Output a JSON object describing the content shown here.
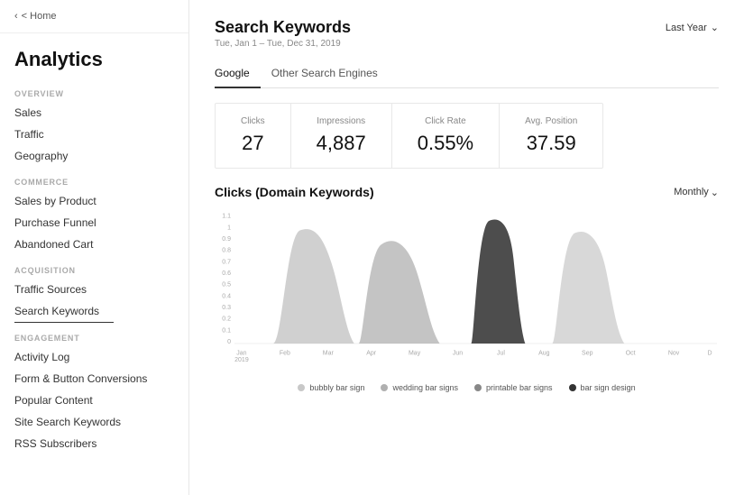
{
  "sidebar": {
    "home_label": "< Home",
    "title": "Analytics",
    "sections": [
      {
        "label": "OVERVIEW",
        "items": [
          "Sales",
          "Traffic",
          "Geography"
        ]
      },
      {
        "label": "COMMERCE",
        "items": [
          "Sales by Product",
          "Purchase Funnel",
          "Abandoned Cart"
        ]
      },
      {
        "label": "ACQUISITION",
        "items": [
          "Traffic Sources",
          "Search Keywords"
        ]
      },
      {
        "label": "ENGAGEMENT",
        "items": [
          "Activity Log",
          "Form & Button Conversions",
          "Popular Content",
          "Site Search Keywords",
          "RSS Subscribers"
        ]
      }
    ],
    "active_item": "Search Keywords"
  },
  "main": {
    "page_title": "Search Keywords",
    "page_date": "Tue, Jan 1 – Tue, Dec 31, 2019",
    "date_range": "Last Year",
    "tabs": [
      "Google",
      "Other Search Engines"
    ],
    "active_tab": "Google",
    "stats": [
      {
        "label": "Clicks",
        "value": "27"
      },
      {
        "label": "Impressions",
        "value": "4,887"
      },
      {
        "label": "Click Rate",
        "value": "0.55%"
      },
      {
        "label": "Avg. Position",
        "value": "37.59"
      }
    ],
    "chart_title": "Clicks (Domain Keywords)",
    "chart_control": "Monthly",
    "x_labels": [
      "Jan\n2019",
      "Feb",
      "Mar",
      "Apr",
      "May",
      "Jun",
      "Jul",
      "Aug",
      "Sep",
      "Oct",
      "Nov",
      "D"
    ],
    "legend": [
      {
        "label": "bubbly bar sign",
        "color": "#c8c8c8"
      },
      {
        "label": "wedding bar signs",
        "color": "#b0b0b0"
      },
      {
        "label": "printable bar signs",
        "color": "#888888"
      },
      {
        "label": "bar sign design",
        "color": "#333333"
      }
    ]
  }
}
